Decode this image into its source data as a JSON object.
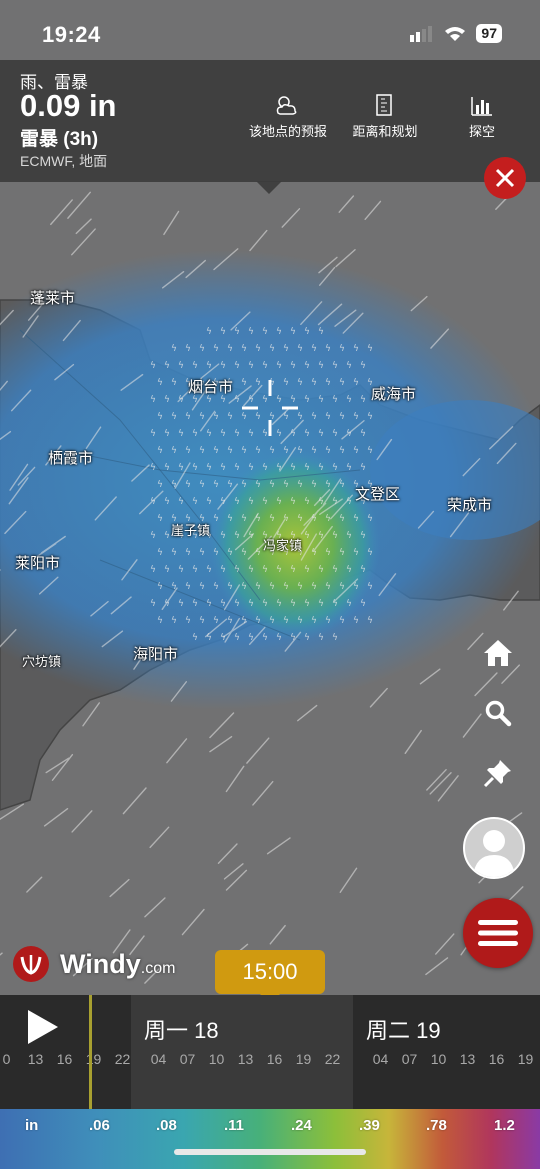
{
  "status_bar": {
    "time": "19:24",
    "battery": "97"
  },
  "header": {
    "weather_type": "雨、雷暴",
    "value": "0.09 in",
    "subtitle": "雷暴 (3h)",
    "model": "ECMWF, 地面",
    "tools": [
      {
        "label": "该地点的预报",
        "icon": "cloud-sun-icon"
      },
      {
        "label": "距离和规划",
        "icon": "ruler-icon"
      },
      {
        "label": "探空",
        "icon": "bar-chart-icon"
      }
    ]
  },
  "map": {
    "places": [
      "蓬莱市",
      "烟台市",
      "威海市",
      "栖霞市",
      "文登区",
      "荣成市",
      "崖子镇",
      "冯家镇",
      "莱阳市",
      "海阳市",
      "穴坊镇"
    ]
  },
  "controls": [
    "home-icon",
    "search-icon",
    "pin-icon",
    "avatar",
    "menu-icon"
  ],
  "brand": {
    "name": "Windy",
    "suffix": ".com"
  },
  "timeline": {
    "current_time": "15:00",
    "days": [
      {
        "label": "",
        "hours": [
          "0",
          "13",
          "16",
          "19",
          "22"
        ]
      },
      {
        "label": "周一 18",
        "hours": [
          "04",
          "07",
          "10",
          "13",
          "16",
          "19",
          "22"
        ]
      },
      {
        "label": "周二 19",
        "hours": [
          "04",
          "07",
          "10",
          "13",
          "16",
          "19"
        ]
      }
    ]
  },
  "legend": {
    "unit": "in",
    "values": [
      ".06",
      ".08",
      ".11",
      ".24",
      ".39",
      ".78",
      "1.2"
    ]
  },
  "colors": {
    "accent": "#d09a10",
    "close": "#c41e1e",
    "menu": "#b01a1a"
  }
}
